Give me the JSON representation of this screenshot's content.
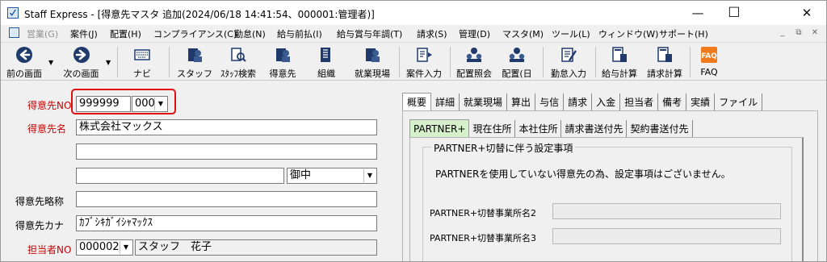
{
  "window": {
    "title": "Staff Express - [得意先マスタ  追加(2024/06/18 14:41:54、000001:管理者)]",
    "minimize": "—",
    "maximize": "☐",
    "close": "✕"
  },
  "menu": {
    "items": [
      {
        "label": "営業(G)",
        "disabled": true
      },
      {
        "label": "案件(J)",
        "disabled": false
      },
      {
        "label": "配置(H)",
        "disabled": false
      },
      {
        "label": "コンプライアンス(C)",
        "disabled": false
      },
      {
        "label": "勤怠(N)",
        "disabled": false
      },
      {
        "label": "給与前払(I)",
        "disabled": false
      },
      {
        "label": "給与賞与年調(T)",
        "disabled": false
      },
      {
        "label": "請求(S)",
        "disabled": false
      },
      {
        "label": "管理(D)",
        "disabled": false
      },
      {
        "label": "マスタ(M)",
        "disabled": false
      },
      {
        "label": "ツール(L)",
        "disabled": false
      },
      {
        "label": "ウィンドウ(W)",
        "disabled": false
      },
      {
        "label": "サポート(H)",
        "disabled": false
      }
    ],
    "mdi_min": "_",
    "mdi_restore": "⧉",
    "mdi_close": "✕"
  },
  "toolbar": {
    "items": [
      {
        "label": "前の画面",
        "icon": "back-arrow-icon"
      },
      {
        "label": "次の画面",
        "icon": "forward-arrow-icon"
      },
      {
        "label": "ナビ",
        "icon": "keyboard-icon"
      },
      {
        "label": "スタッフ",
        "icon": "staff-icon"
      },
      {
        "label": "ｽﾀｯﾌ検索",
        "icon": "staff-search-icon"
      },
      {
        "label": "得意先",
        "icon": "customer-icon"
      },
      {
        "label": "組織",
        "icon": "organization-icon"
      },
      {
        "label": "就業現場",
        "icon": "worksite-icon"
      },
      {
        "label": "案件入力",
        "icon": "project-entry-icon"
      },
      {
        "label": "配置照会",
        "icon": "assignment-inquiry-icon"
      },
      {
        "label": "配置(日",
        "icon": "assignment-daily-icon"
      },
      {
        "label": "勤怠入力",
        "icon": "attendance-entry-icon"
      },
      {
        "label": "給与計算",
        "icon": "payroll-icon"
      },
      {
        "label": "請求計算",
        "icon": "billing-icon"
      },
      {
        "label": "FAQ",
        "icon": "faq-icon"
      }
    ]
  },
  "form": {
    "customer_no_label": "得意先NO",
    "customer_no": "999999",
    "customer_no_sep": "-",
    "customer_branch": "000",
    "customer_name_label": "得意先名",
    "customer_name": "株式会社マックス",
    "name2": "",
    "name3": "",
    "honorific": "御中",
    "short_name_label": "得意先略称",
    "short_name": "",
    "kana_label": "得意先カナ",
    "kana": "ｶﾌﾞｼｷｶﾞｲｼｬﾏｯｸｽ",
    "staff_no_label": "担当者NO",
    "staff_no": "000002",
    "staff_name": "スタッフ　花子"
  },
  "tabs": [
    "概要",
    "詳細",
    "就業現場",
    "算出",
    "与信",
    "請求",
    "入金",
    "担当者",
    "備考",
    "実績",
    "ファイル"
  ],
  "subtabs": [
    "PARTNER+",
    "現在住所",
    "本社住所",
    "請求書送付先",
    "契約書送付先"
  ],
  "partner": {
    "group_title": "PARTNER+切替に伴う設定事項",
    "message": "PARTNERを使用していない得意先の為、設定事項はございません。",
    "field2_label": "PARTNER+切替事業所名2",
    "field3_label": "PARTNER+切替事業所名3"
  },
  "colors": {
    "required_label": "#cc0000",
    "highlight": "#e01010",
    "active_subtab": "#d7f0cc"
  }
}
